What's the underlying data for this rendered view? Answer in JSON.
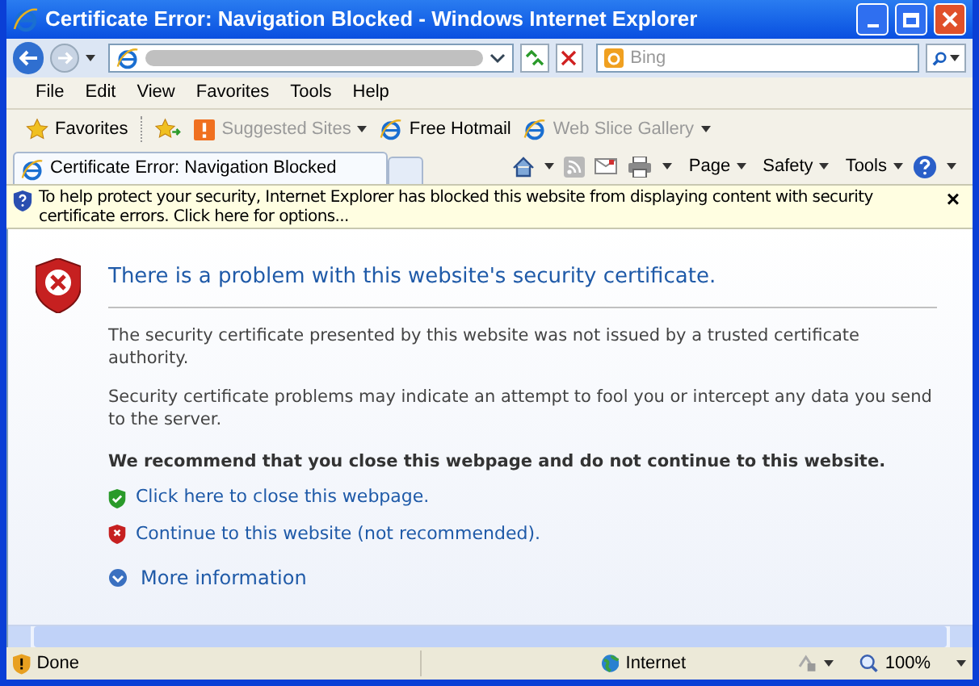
{
  "window": {
    "title": "Certificate Error: Navigation Blocked - Windows Internet Explorer"
  },
  "search": {
    "placeholder": "Bing"
  },
  "menu": [
    "File",
    "Edit",
    "View",
    "Favorites",
    "Tools",
    "Help"
  ],
  "favorites_bar": {
    "label": "Favorites",
    "items": [
      {
        "label": "Suggested Sites",
        "disabled": true,
        "dropdown": true
      },
      {
        "label": "Free Hotmail",
        "disabled": false,
        "dropdown": false
      },
      {
        "label": "Web Slice Gallery",
        "disabled": true,
        "dropdown": true
      }
    ]
  },
  "tab": {
    "label": "Certificate Error: Navigation Blocked",
    "selected": true
  },
  "command_bar": [
    "Page",
    "Safety",
    "Tools"
  ],
  "info_bar": {
    "text": "To help protect your security, Internet Explorer has blocked this website from displaying content with security certificate errors. Click here for options...",
    "close": "×"
  },
  "content": {
    "heading": "There is a problem with this website's security certificate.",
    "paragraphs": [
      "The security certificate presented by this website was not issued by a trusted certificate authority.",
      "Security certificate problems may indicate an attempt to fool you or intercept any data you send to the server."
    ],
    "recommendation": "We recommend that you close this webpage and do not continue to this website.",
    "links": [
      {
        "kind": "safe",
        "label": "Click here to close this webpage."
      },
      {
        "kind": "danger",
        "label": "Continue to this website (not recommended)."
      }
    ],
    "more": "More information"
  },
  "status_bar": {
    "text": "Done",
    "zone": "Internet",
    "zoom": "100%"
  }
}
